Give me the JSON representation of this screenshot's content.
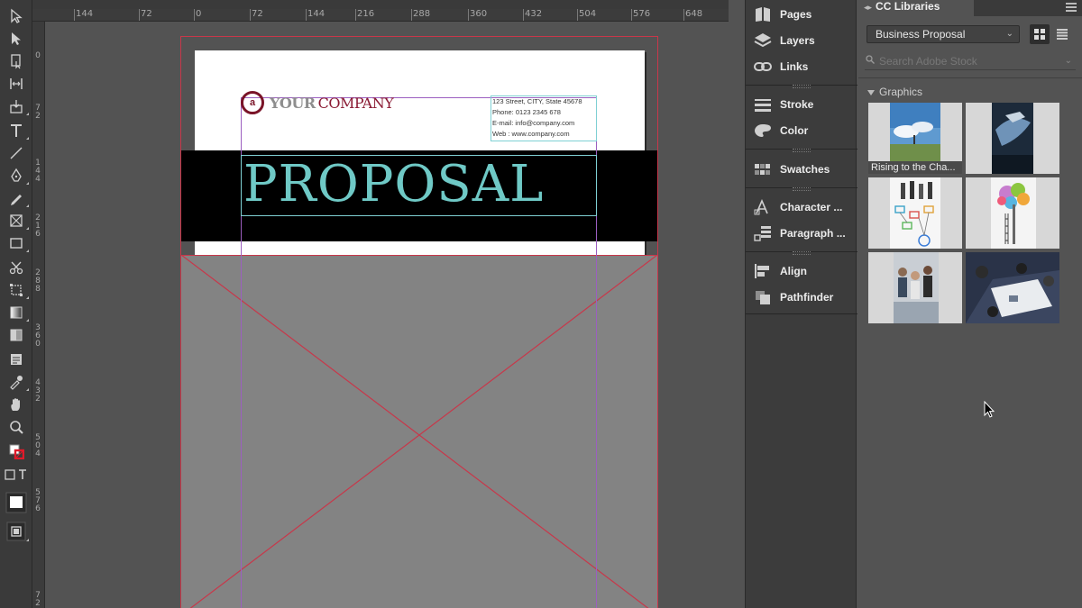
{
  "ruler": {
    "h_ticks": [
      "144",
      "72",
      "0",
      "72",
      "144",
      "216",
      "288",
      "360",
      "432",
      "504",
      "576",
      "648"
    ],
    "v_ticks": [
      "0",
      "7 2",
      "1 4 4",
      "2 1 6",
      "2 8 8",
      "3 6 0",
      "4 3 2",
      "5 0 4",
      "5 7 6",
      "7 2"
    ]
  },
  "document": {
    "logo_mark": "a",
    "logo_your": "YOUR",
    "logo_company": "COMPANY",
    "contact": {
      "line1": "123 Street, CITY, State 45678",
      "line2": "Phone: 0123 2345 678",
      "line3": "E-mail: info@company.com",
      "line4": "Web : www.company.com"
    },
    "headline": "PROPOSAL",
    "colors": {
      "brand": "#8a1a33",
      "headline": "#6fc9c6",
      "bleed_guide": "#c8374a",
      "margin_guide": "#9b5fc0",
      "frame_select": "#7fd0d4"
    }
  },
  "panels": {
    "items": [
      {
        "label": "Pages",
        "icon": "pages-icon"
      },
      {
        "label": "Layers",
        "icon": "layers-icon"
      },
      {
        "label": "Links",
        "icon": "links-icon"
      },
      {
        "label": "Stroke",
        "icon": "stroke-icon"
      },
      {
        "label": "Color",
        "icon": "color-icon"
      },
      {
        "label": "Swatches",
        "icon": "swatches-icon"
      },
      {
        "label": "Character ...",
        "icon": "character-icon"
      },
      {
        "label": "Paragraph ...",
        "icon": "paragraph-icon"
      },
      {
        "label": "Align",
        "icon": "align-icon"
      },
      {
        "label": "Pathfinder",
        "icon": "pathfinder-icon"
      }
    ]
  },
  "library": {
    "tab_label": "CC Libraries",
    "selected_library": "Business Proposal",
    "search_placeholder": "Search Adobe Stock",
    "section_label": "Graphics",
    "first_item_caption": "Rising to the Cha..."
  }
}
